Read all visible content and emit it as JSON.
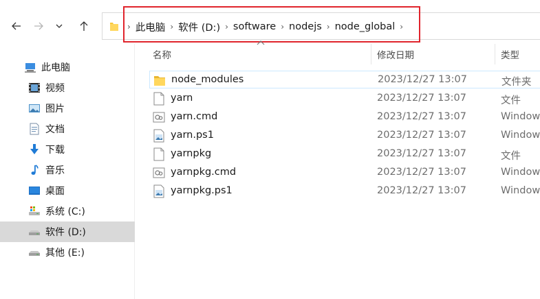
{
  "address_bar": {
    "breadcrumbs": [
      "此电脑",
      "软件 (D:)",
      "software",
      "nodejs",
      "node_global"
    ]
  },
  "columns": {
    "name": "名称",
    "modified": "修改日期",
    "type": "类型"
  },
  "sidebar": {
    "items": [
      {
        "label": "此电脑",
        "icon": "computer-icon"
      },
      {
        "label": "视频",
        "icon": "video-icon"
      },
      {
        "label": "图片",
        "icon": "picture-icon"
      },
      {
        "label": "文档",
        "icon": "document-icon"
      },
      {
        "label": "下载",
        "icon": "download-icon"
      },
      {
        "label": "音乐",
        "icon": "music-icon"
      },
      {
        "label": "桌面",
        "icon": "desktop-icon"
      },
      {
        "label": "系统 (C:)",
        "icon": "system-drive-icon"
      },
      {
        "label": "软件 (D:)",
        "icon": "drive-icon",
        "selected": true
      },
      {
        "label": "其他 (E:)",
        "icon": "drive-icon"
      }
    ]
  },
  "files": [
    {
      "name": "node_modules",
      "modified": "2023/12/27 13:07",
      "type": "文件夹",
      "icon": "folder-icon"
    },
    {
      "name": "yarn",
      "modified": "2023/12/27 13:07",
      "type": "文件",
      "icon": "file-icon"
    },
    {
      "name": "yarn.cmd",
      "modified": "2023/12/27 13:07",
      "type": "Window",
      "icon": "cmd-file-icon"
    },
    {
      "name": "yarn.ps1",
      "modified": "2023/12/27 13:07",
      "type": "Window",
      "icon": "ps1-file-icon"
    },
    {
      "name": "yarnpkg",
      "modified": "2023/12/27 13:07",
      "type": "文件",
      "icon": "file-icon"
    },
    {
      "name": "yarnpkg.cmd",
      "modified": "2023/12/27 13:07",
      "type": "Window",
      "icon": "cmd-file-icon"
    },
    {
      "name": "yarnpkg.ps1",
      "modified": "2023/12/27 13:07",
      "type": "Window",
      "icon": "ps1-file-icon"
    }
  ],
  "colors": {
    "highlight": "#e0232b",
    "selected_bg": "#d9d9d9",
    "folder": "#f8c73a"
  }
}
